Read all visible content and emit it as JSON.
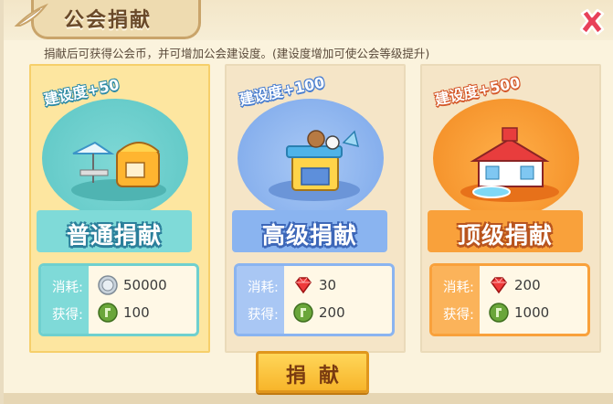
{
  "title": "公会捐献",
  "description": "捐献后可获得公会币，并可增加公会建设度。(建设度增加可使公会等级提升)",
  "cost_label": "消耗:",
  "gain_label": "获得:",
  "cards": [
    {
      "name": "普通捐献",
      "bonus": "建设度+50",
      "cost": "50000",
      "cost_icon": "silver-coin-icon",
      "gain": "100",
      "gain_icon": "guild-coin-icon",
      "selected": true
    },
    {
      "name": "高级捐献",
      "bonus": "建设度+100",
      "cost": "30",
      "cost_icon": "ruby-gem-icon",
      "gain": "200",
      "gain_icon": "guild-coin-icon",
      "selected": false
    },
    {
      "name": "顶级捐献",
      "bonus": "建设度+500",
      "cost": "200",
      "cost_icon": "ruby-gem-icon",
      "gain": "1000",
      "gain_icon": "guild-coin-icon",
      "selected": false
    }
  ],
  "donate_button": "捐献",
  "colors": {
    "accent": "#f7b52a",
    "close": "#e8415a",
    "card1": "#7fdad8",
    "card2": "#8ab4f0",
    "card3": "#f9a13b"
  }
}
